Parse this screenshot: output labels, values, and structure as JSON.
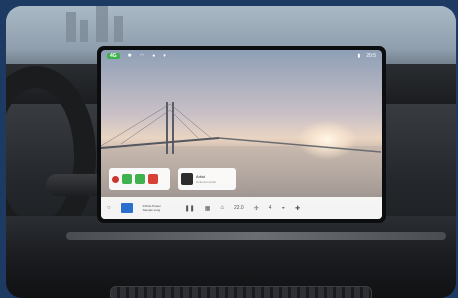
{
  "status_bar": {
    "badge": "4G",
    "icons": [
      "bluetooth-icon",
      "wifi-icon",
      "mic-icon",
      "location-icon"
    ],
    "time": "20:5"
  },
  "phone_card": {
    "icons": [
      "phone-icon",
      "accept-call-icon",
      "end-call-icon"
    ]
  },
  "music_card": {
    "title": "Artist",
    "subtitle": "Unknown Artist"
  },
  "dock": {
    "now_playing_title": "Infinite Power",
    "now_playing_sub": "Sample song",
    "temperature": "22.0",
    "fan_level": "4",
    "icons": [
      "home-icon",
      "play-pause-icon",
      "menu-icon",
      "car-icon",
      "fan-icon",
      "user-icon"
    ]
  },
  "colors": {
    "accent_green": "#3fb24f",
    "end_call_red": "#d84236"
  }
}
